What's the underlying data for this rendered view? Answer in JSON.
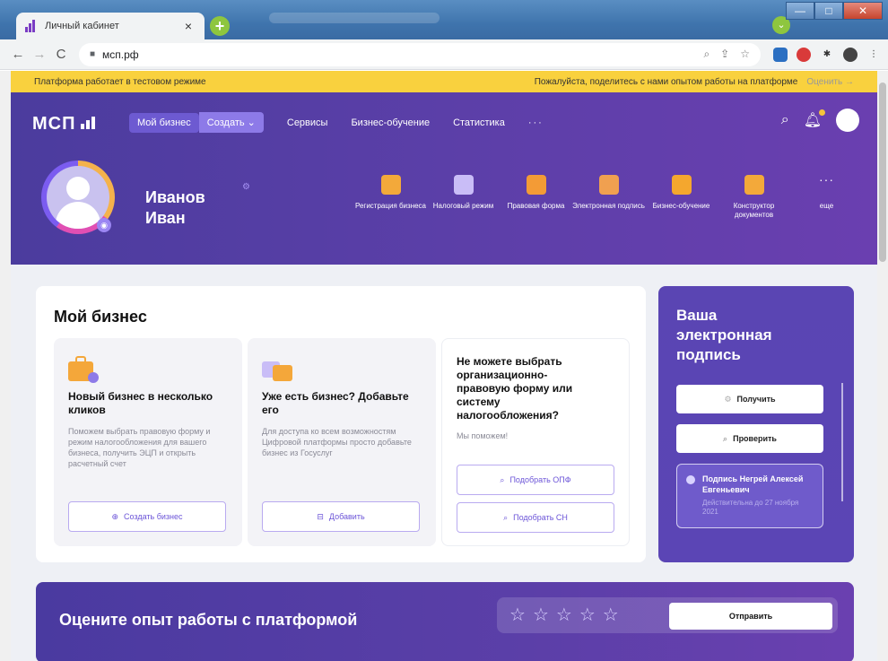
{
  "browser": {
    "tab_title": "Личный кабинет",
    "tab_close": "×",
    "new_tab": "+",
    "url": "мсп.рф",
    "window_controls": {
      "minimize": "—",
      "maximize": "□",
      "close": "✕"
    }
  },
  "banner": {
    "left": "Платформа работает в тестовом режиме",
    "right": "Пожалуйста, поделитесь с нами опытом работы на платформе",
    "rate": "Оценить →"
  },
  "header": {
    "logo": "МСП",
    "nav": {
      "my_business": "Мой бизнес",
      "create": "Создать ⌄",
      "services": "Сервисы",
      "learning": "Бизнес-обучение",
      "stats": "Статистика",
      "more": "···"
    }
  },
  "profile": {
    "name_line1": "Иванов",
    "name_line2": "Иван"
  },
  "quick_actions": [
    {
      "label": "Регистрация бизнеса",
      "color": "#f3a93a"
    },
    {
      "label": "Налоговый режим",
      "color": "#c9bdf7"
    },
    {
      "label": "Правовая форма",
      "color": "#f39b36"
    },
    {
      "label": "Электронная подпись",
      "color": "#f0a050"
    },
    {
      "label": "Бизнес-обучение",
      "color": "#f4a72e"
    },
    {
      "label": "Конструктор документов",
      "color": "#f3a93a"
    }
  ],
  "quick_more": {
    "dots": "···",
    "label": "еще"
  },
  "my_business": {
    "title": "Мой бизнес",
    "card1": {
      "title": "Новый бизнес в несколько кликов",
      "text": "Поможем выбрать правовую форму и режим налогообложения для вашего бизнеса, получить ЭЦП и открыть расчетный счет",
      "button": "Создать бизнес"
    },
    "card2": {
      "title": "Уже есть бизнес? Добавьте его",
      "text": "Для доступа ко всем возможностям Цифровой платформы просто добавьте бизнес из Госуслуг",
      "button": "Добавить"
    },
    "card3": {
      "title": "Не можете выбрать организационно-правовую форму или систему налогообложения?",
      "text": "Мы поможем!",
      "button1": "Подобрать ОПФ",
      "button2": "Подобрать СН"
    }
  },
  "signature": {
    "title": "Ваша электронная подпись",
    "get": "Получить",
    "check": "Проверить",
    "holder": "Подпись Негрей Алексей Евгеньевич",
    "valid": "Действительна до 27 ноября 2021"
  },
  "rating": {
    "title": "Оцените опыт работы с платформой",
    "stars": 0,
    "send": "Отправить"
  }
}
